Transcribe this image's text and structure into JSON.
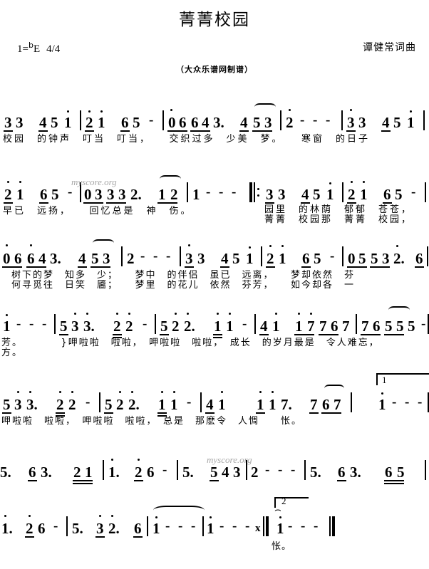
{
  "header": {
    "title": "菁菁校园",
    "key_prefix": "1=",
    "key_flat": "b",
    "key_note": "E",
    "meter": "4/4",
    "credit": "谭健常词曲",
    "source_note": "（大众乐谱网制谱）"
  },
  "watermark": {
    "text": "myscore.org"
  },
  "score": {
    "lines": [
      {
        "id": "line-1",
        "measures": [
          {
            "tokens": [
              "3",
              "3",
              "4",
              "5",
              "1"
            ]
          },
          {
            "tokens": [
              "2",
              "1",
              "6",
              "5",
              "-"
            ]
          },
          {
            "tokens": [
              "0",
              "6",
              "6",
              "4",
              "3.",
              "4",
              "5",
              "3"
            ]
          },
          {
            "tokens": [
              "2",
              "-",
              "-",
              "-"
            ]
          },
          {
            "tokens": [
              "3",
              "3",
              "4",
              "5",
              "1"
            ]
          }
        ],
        "lyrics": [
          "校园　的钟声　叮当　叮当，　　交织过多　少美　梦。　　寒窗　的日子"
        ]
      },
      {
        "id": "line-2",
        "measures": [
          {
            "tokens": [
              "2",
              "1",
              "6",
              "5",
              "-"
            ]
          },
          {
            "tokens": [
              "0",
              "3",
              "3",
              "3",
              "2.",
              "1",
              "2"
            ]
          },
          {
            "tokens": [
              "1",
              "-",
              "-",
              "-"
            ]
          },
          {
            "tokens": [
              "3",
              "3",
              "4",
              "5",
              "1"
            ]
          },
          {
            "tokens": [
              "2",
              "1",
              "6",
              "5",
              "-"
            ]
          }
        ],
        "lyrics": [
          "早已　远扬，　　回忆总是　神　伤。",
          "园里　的林荫　郁郁　苍苍，",
          "菁菁　校园那　菁菁　校园，"
        ]
      },
      {
        "id": "line-3",
        "measures": [
          {
            "tokens": [
              "0",
              "6",
              "6",
              "4",
              "3.",
              "4",
              "5",
              "3"
            ]
          },
          {
            "tokens": [
              "2",
              "-",
              "-",
              "-"
            ]
          },
          {
            "tokens": [
              "3",
              "3",
              "4",
              "5",
              "1"
            ]
          },
          {
            "tokens": [
              "2",
              "1",
              "6",
              "5",
              "-"
            ]
          },
          {
            "tokens": [
              "0",
              "5",
              "5",
              "3",
              "2.",
              "6"
            ]
          }
        ],
        "lyrics": [
          "树下的梦　知多　少；　　梦中　的伴侣　虽已　远离，　　梦却依然　芬",
          "何寻觅往　日笑　靥；　　梦里　的花儿　依然　芬芳，　　如今却各　一"
        ]
      },
      {
        "id": "line-4",
        "measures": [
          {
            "tokens": [
              "1",
              "-",
              "-",
              "-"
            ]
          },
          {
            "tokens": [
              "5",
              "3",
              "3.",
              "2",
              "2",
              "-"
            ]
          },
          {
            "tokens": [
              "5",
              "2",
              "2.",
              "1",
              "1",
              "-"
            ]
          },
          {
            "tokens": [
              "4",
              "1",
              "1",
              "7",
              "7",
              "6",
              "7"
            ]
          },
          {
            "tokens": [
              "7",
              "6",
              "5",
              "5",
              "5",
              "-"
            ]
          }
        ],
        "lyrics": [
          "芳。　　　　}呷啦啦　啦啦，　呷啦啦　啦啦，　成长　的岁月最是　令人难忘，",
          "方。"
        ]
      },
      {
        "id": "line-5",
        "measures": [
          {
            "tokens": [
              "5",
              "3",
              "3.",
              "2",
              "2",
              "-"
            ]
          },
          {
            "tokens": [
              "5",
              "2",
              "2.",
              "1",
              "1",
              "-"
            ]
          },
          {
            "tokens": [
              "4",
              "1",
              "1",
              "1",
              "7.",
              "7",
              "6",
              "7"
            ]
          },
          {
            "tokens": [
              "1",
              "-",
              "-",
              "-"
            ]
          }
        ],
        "lyrics": [
          "呷啦啦　啦啦，　呷啦啦　啦啦，　总是　那麽令　人惆　　怅。"
        ],
        "volta": {
          "number": "1"
        }
      },
      {
        "id": "line-6",
        "measures": [
          {
            "tokens": [
              "5.",
              "6",
              "3.",
              "2",
              "1"
            ]
          },
          {
            "tokens": [
              "1.",
              "2",
              "6",
              "-"
            ]
          },
          {
            "tokens": [
              "5.",
              "5",
              "4",
              "3",
              "2",
              "-",
              "-",
              "-"
            ]
          },
          {
            "tokens": [
              "5.",
              "6",
              "3.",
              "6",
              "5"
            ]
          }
        ],
        "lyrics": [
          ""
        ]
      },
      {
        "id": "line-7",
        "measures": [
          {
            "tokens": [
              "1.",
              "2",
              "6",
              "-"
            ]
          },
          {
            "tokens": [
              "5.",
              "3",
              "2.",
              "6"
            ]
          },
          {
            "tokens": [
              "1",
              "-",
              "-",
              "-"
            ]
          },
          {
            "tokens": [
              "1",
              "-",
              "-",
              "-"
            ]
          },
          {
            "tokens": [
              "1",
              "-",
              "-",
              "-"
            ]
          }
        ],
        "lyrics": [
          "怅。"
        ],
        "volta": {
          "number": "2"
        }
      }
    ]
  }
}
